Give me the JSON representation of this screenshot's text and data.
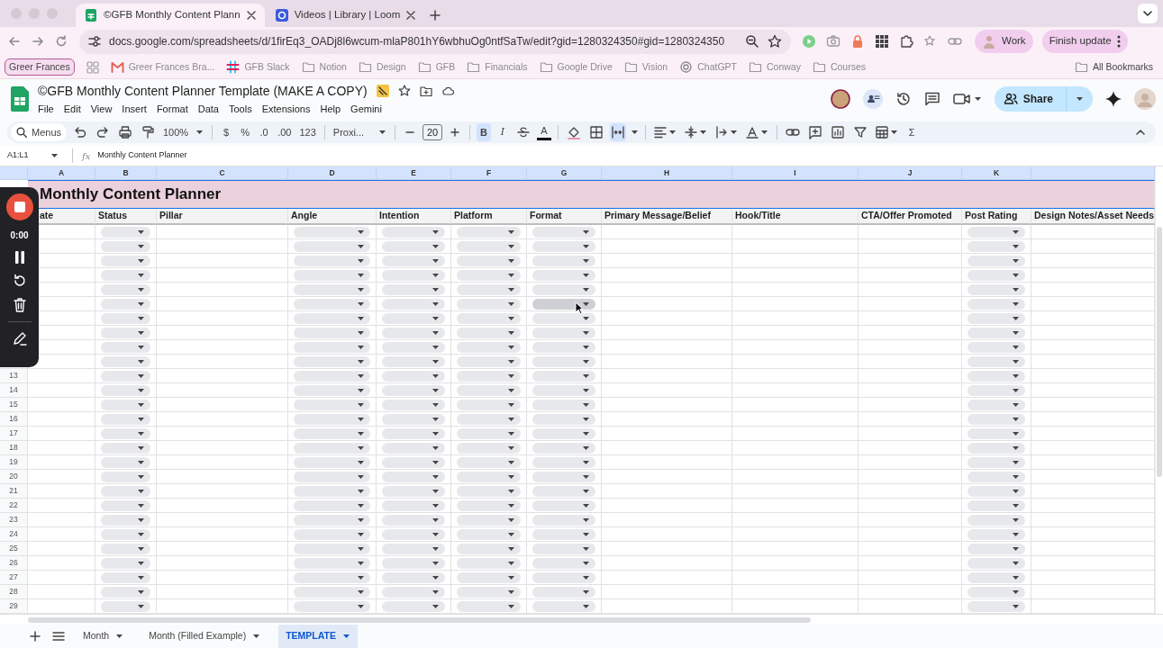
{
  "browser": {
    "tabs": [
      {
        "title": "©GFB Monthly Content Plann",
        "selected": true
      },
      {
        "title": "Videos | Library | Loom",
        "selected": false
      }
    ],
    "url": "docs.google.com/spreadsheets/d/1firEq3_OADj8l6wcum-mlaP801hY6wbhuOg0ntfSaTw/edit?gid=1280324350#gid=1280324350",
    "profile": "Work",
    "update_button": "Finish update"
  },
  "bookmarks": [
    {
      "kind": "profile",
      "label": "Greer Frances"
    },
    {
      "kind": "apps"
    },
    {
      "kind": "gmail",
      "label": "Greer Frances Bra..."
    },
    {
      "kind": "slack",
      "label": "GFB Slack"
    },
    {
      "kind": "folder",
      "label": "Notion"
    },
    {
      "kind": "folder",
      "label": "Design"
    },
    {
      "kind": "folder",
      "label": "GFB"
    },
    {
      "kind": "folder",
      "label": "Financials"
    },
    {
      "kind": "folder",
      "label": "Google Drive"
    },
    {
      "kind": "folder",
      "label": "Vision"
    },
    {
      "kind": "chatgpt",
      "label": "ChatGPT"
    },
    {
      "kind": "folder",
      "label": "Conway"
    },
    {
      "kind": "folder",
      "label": "Courses"
    }
  ],
  "all_bookmarks": "All Bookmarks",
  "doc": {
    "title": "©GFB Monthly Content Planner Template (MAKE A COPY)",
    "menu": [
      "File",
      "Edit",
      "View",
      "Insert",
      "Format",
      "Data",
      "Tools",
      "Extensions",
      "Help",
      "Gemini"
    ],
    "share": "Share"
  },
  "toolbar": {
    "search": "Menus",
    "zoom": "100%",
    "currency": "$",
    "percent": "%",
    "decrease_decimals": ".0",
    "increase_decimals": ".00",
    "number_format": "123",
    "font": "Proxi...",
    "font_size": "20",
    "bold": {
      "label": "B",
      "on": true
    },
    "italic": {
      "label": "I",
      "on": false
    },
    "text_color": "A",
    "merge_on": true,
    "sum": "Σ"
  },
  "formula_bar": {
    "name_box": "A1:L1",
    "fx": "fx",
    "content": "Monthly Content Planner"
  },
  "sheet": {
    "title": "Monthly Content Planner",
    "columns": [
      {
        "letter": "A",
        "header": "ate",
        "kind": "text"
      },
      {
        "letter": "B",
        "header": "Status",
        "kind": "dropdown"
      },
      {
        "letter": "C",
        "header": "Pillar",
        "kind": "text"
      },
      {
        "letter": "D",
        "header": "Angle",
        "kind": "dropdown"
      },
      {
        "letter": "E",
        "header": "Intention",
        "kind": "dropdown"
      },
      {
        "letter": "F",
        "header": "Platform",
        "kind": "dropdown"
      },
      {
        "letter": "G",
        "header": "Format",
        "kind": "dropdown"
      },
      {
        "letter": "H",
        "header": "Primary Message/Belief",
        "kind": "text"
      },
      {
        "letter": "I",
        "header": "Hook/Title",
        "kind": "text"
      },
      {
        "letter": "J",
        "header": "CTA/Offer Promoted",
        "kind": "text"
      },
      {
        "letter": "K",
        "header": "Post Rating",
        "kind": "dropdown"
      },
      {
        "header": "Design Notes/Asset Needs",
        "kind": "text"
      }
    ],
    "rows": [
      {
        "format_hovered": false
      },
      {
        "format_hovered": false
      },
      {
        "format_hovered": false
      },
      {
        "format_hovered": false
      },
      {
        "format_hovered": false
      },
      {
        "format_hovered": true
      },
      {
        "format_hovered": false
      },
      {
        "format_hovered": false
      },
      {
        "format_hovered": false
      },
      {
        "format_hovered": false
      },
      {
        "number": "13",
        "format_hovered": false
      },
      {
        "number": "14",
        "format_hovered": false
      },
      {
        "number": "15",
        "format_hovered": false
      },
      {
        "number": "16",
        "format_hovered": false
      },
      {
        "number": "17",
        "format_hovered": false
      },
      {
        "number": "18",
        "format_hovered": false
      },
      {
        "number": "19",
        "format_hovered": false
      },
      {
        "number": "20",
        "format_hovered": false
      },
      {
        "number": "21",
        "format_hovered": false
      },
      {
        "number": "22",
        "format_hovered": false
      },
      {
        "number": "23",
        "format_hovered": false
      },
      {
        "number": "24",
        "format_hovered": false
      },
      {
        "number": "25",
        "format_hovered": false
      },
      {
        "number": "26",
        "format_hovered": false
      },
      {
        "number": "27",
        "format_hovered": false
      },
      {
        "number": "28",
        "format_hovered": false
      },
      {
        "number": "29",
        "format_hovered": false
      }
    ]
  },
  "recorder": {
    "time": "0:00"
  },
  "sheet_tabs": [
    {
      "label": "Month",
      "selected": false
    },
    {
      "label": "Month (Filled Example)",
      "selected": false
    },
    {
      "label": "TEMPLATE",
      "selected": true
    }
  ]
}
